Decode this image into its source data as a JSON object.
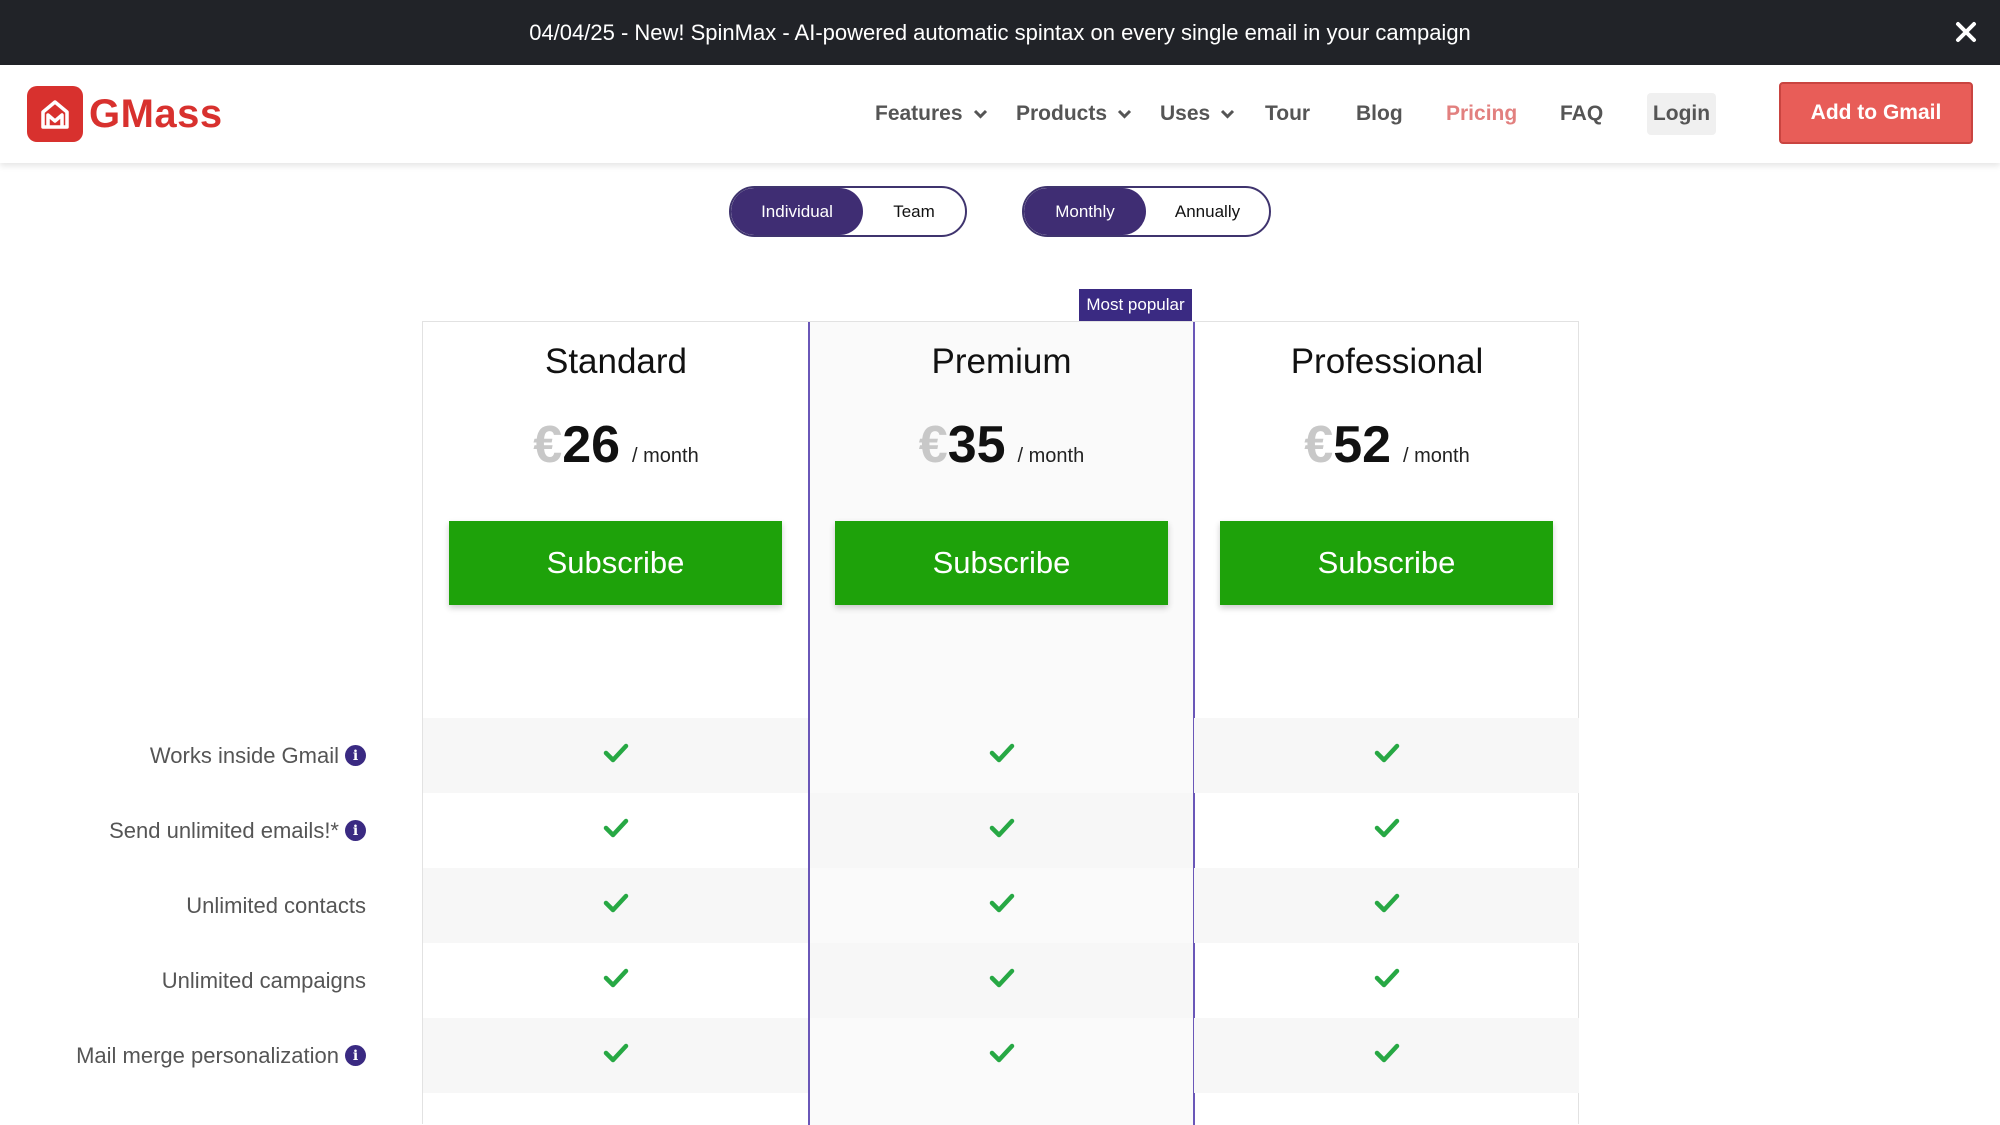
{
  "announcement": {
    "text": "04/04/25 - New! SpinMax - AI-powered automatic spintax on every single email in your campaign"
  },
  "brand": {
    "name": "GMass",
    "color": "#d8312e"
  },
  "nav": {
    "features": "Features",
    "products": "Products",
    "uses": "Uses",
    "tour": "Tour",
    "blog": "Blog",
    "pricing": "Pricing",
    "faq": "FAQ",
    "login": "Login",
    "cta": "Add to Gmail"
  },
  "toggles": {
    "audience": {
      "options": [
        "Individual",
        "Team"
      ],
      "selected": "Individual"
    },
    "billing": {
      "options": [
        "Monthly",
        "Annually"
      ],
      "selected": "Monthly"
    }
  },
  "badge": "Most popular",
  "plans": [
    {
      "name": "Standard",
      "currency": "€",
      "price": "26",
      "period": "/ month",
      "button": "Subscribe"
    },
    {
      "name": "Premium",
      "currency": "€",
      "price": "35",
      "period": "/ month",
      "button": "Subscribe"
    },
    {
      "name": "Professional",
      "currency": "€",
      "price": "52",
      "period": "/ month",
      "button": "Subscribe"
    }
  ],
  "features": [
    {
      "label": "Works inside Gmail",
      "info": true
    },
    {
      "label": "Send unlimited emails!*",
      "info": true
    },
    {
      "label": "Unlimited contacts",
      "info": false
    },
    {
      "label": "Unlimited campaigns",
      "info": false
    },
    {
      "label": "Mail merge personalization",
      "info": true
    }
  ],
  "colors": {
    "accent": "#3f2d73",
    "subscribe": "#1ea20a",
    "check": "#27a844",
    "cta": "#e85d58"
  }
}
